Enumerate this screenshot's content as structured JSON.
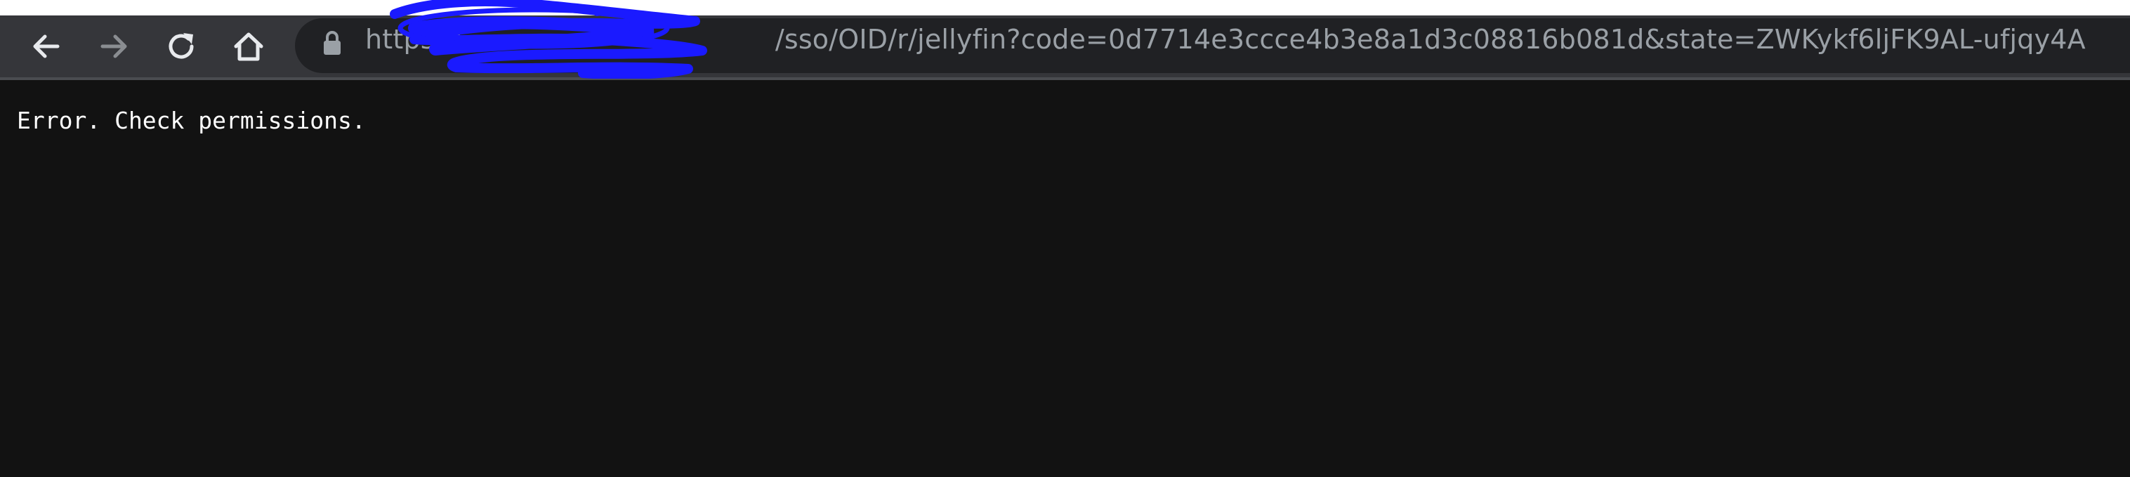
{
  "browser": {
    "url": "https://",
    "url_path": "/sso/OID/r/jellyfin?code=0d7714e3ccce4b3e8a1d3c08816b081d&state=ZWKykf6ljFK9AL-ufjqy4A",
    "icons": [
      "back-icon",
      "forward-icon",
      "reload-icon",
      "home-icon",
      "lock-icon"
    ]
  },
  "page": {
    "message": "Error. Check permissions."
  },
  "colors": {
    "toolbar": "#35363a",
    "omnibox": "#202124",
    "page_background": "#121212",
    "page_text": "#ffffff",
    "url_text": "#9aa0a6",
    "redaction_scribble": "#1a1aff"
  }
}
